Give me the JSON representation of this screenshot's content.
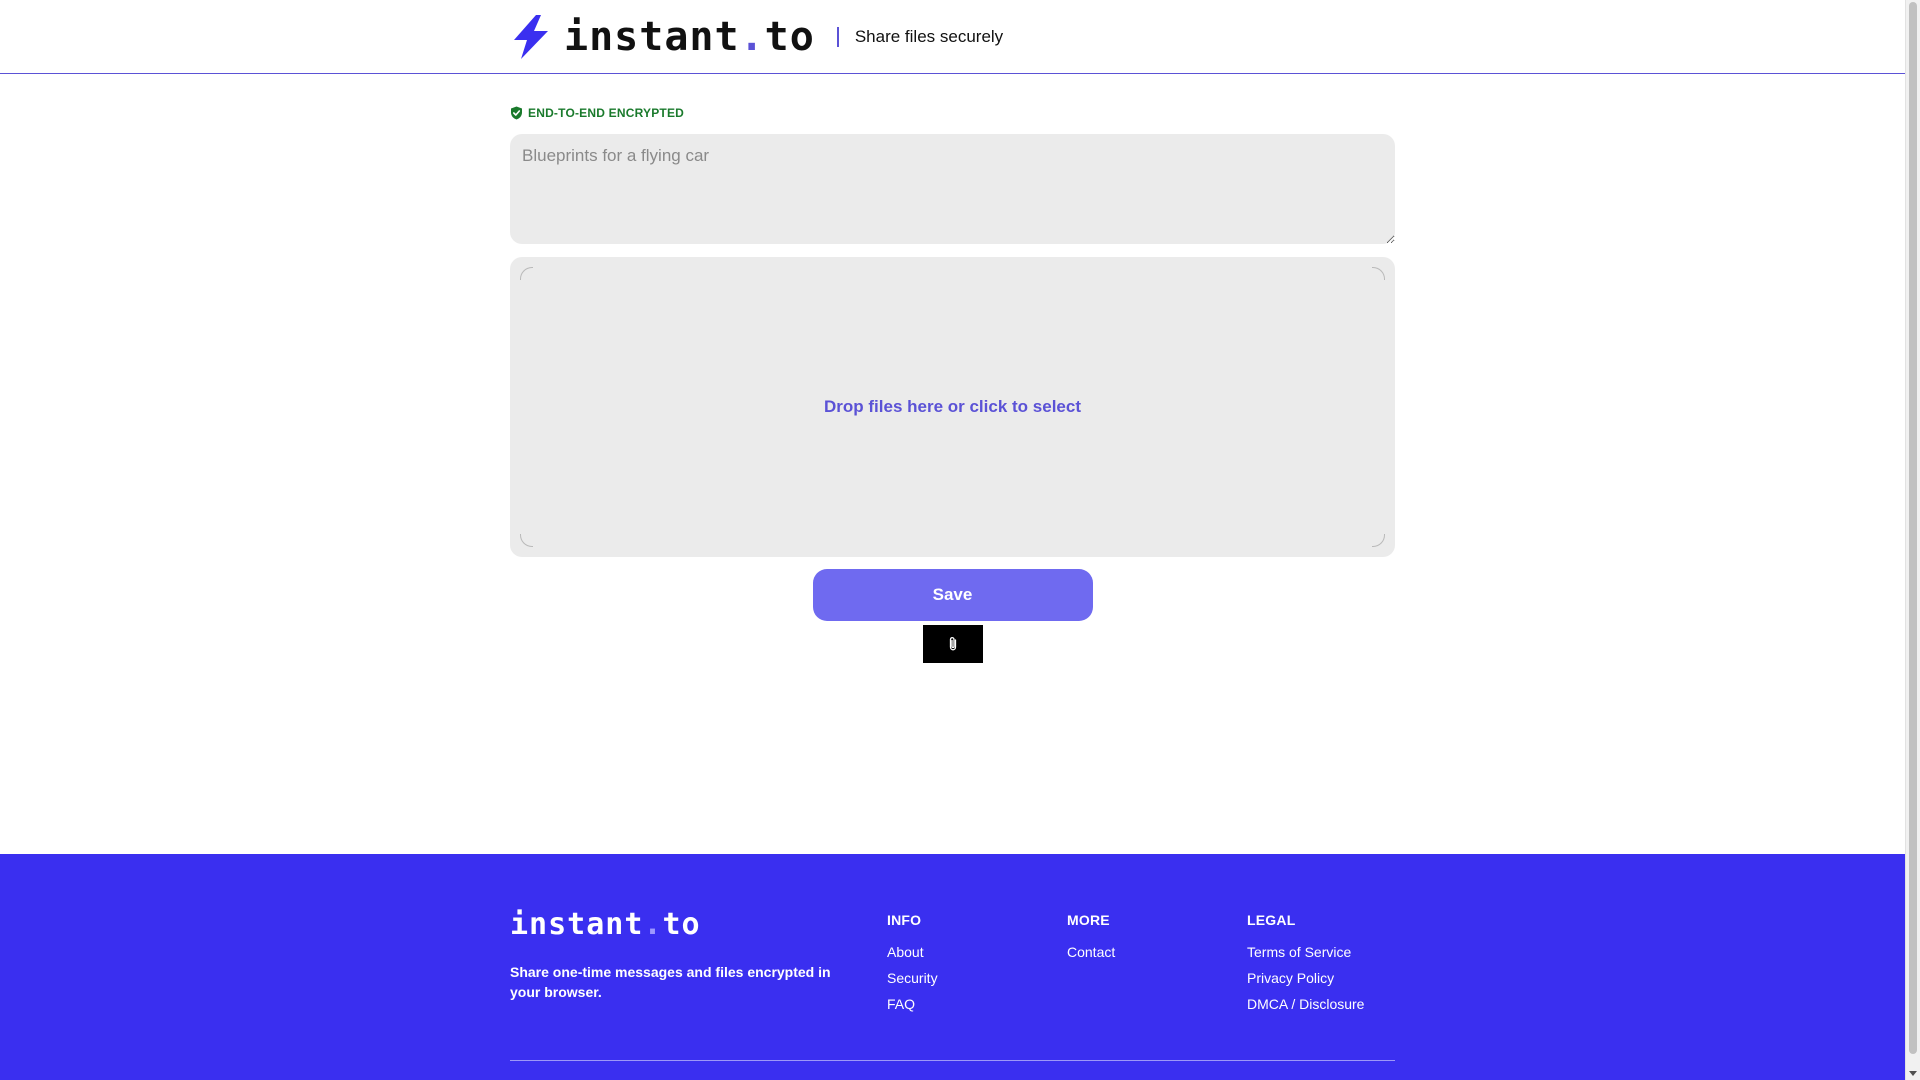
{
  "header": {
    "logo_text": "instant",
    "logo_dot": ".",
    "logo_suffix": "to",
    "tagline": "Share files securely"
  },
  "main": {
    "encryption_badge": "END-TO-END ENCRYPTED",
    "message_placeholder": "Blueprints for a flying car",
    "dropzone_text": "Drop files here or click to select",
    "save_label": "Save"
  },
  "footer": {
    "logo_text": "instant",
    "logo_dot": ".",
    "logo_suffix": "to",
    "description": "Share one-time messages and files encrypted in your browser.",
    "columns": [
      {
        "heading": "INFO",
        "links": [
          "About",
          "Security",
          "FAQ"
        ]
      },
      {
        "heading": "MORE",
        "links": [
          "Contact"
        ]
      },
      {
        "heading": "LEGAL",
        "links": [
          "Terms of Service",
          "Privacy Policy",
          "DMCA / Disclosure"
        ]
      }
    ]
  },
  "colors": {
    "accent": "#5b52d6",
    "footer_bg": "#3a2ff0",
    "save_button": "#6f6af0",
    "encrypted_green": "#1a7a2c"
  },
  "icons": {
    "logo": "lightning-bolt-icon",
    "encrypted": "shield-check-icon",
    "attach": "paperclip-icon"
  }
}
